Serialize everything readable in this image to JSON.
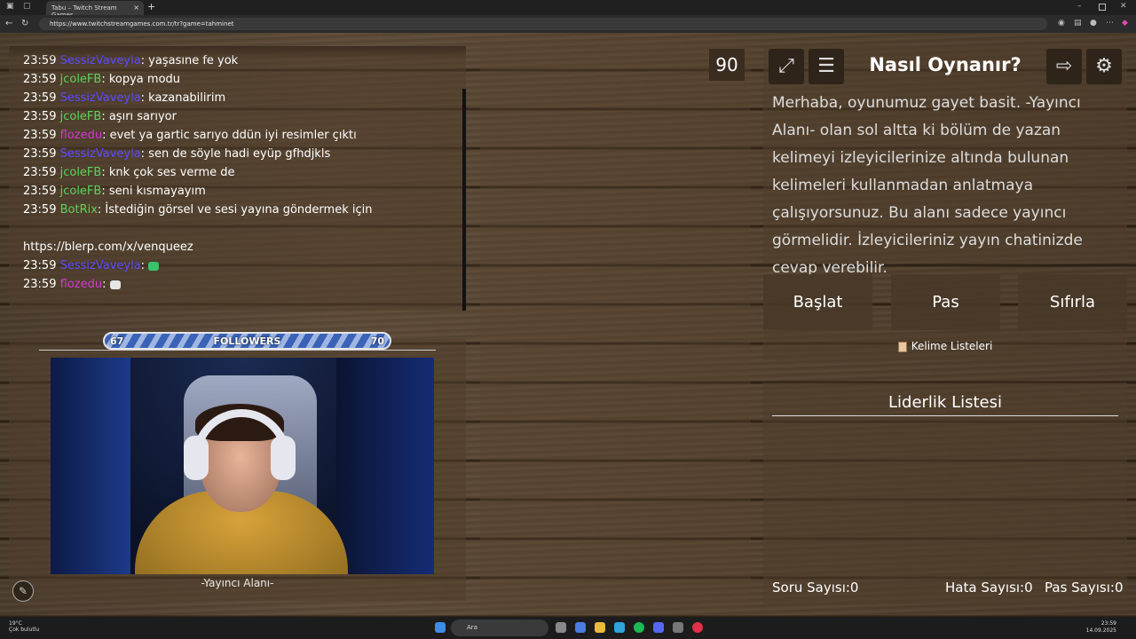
{
  "browser": {
    "tab_title": "Tabu – Twitch Stream Games",
    "url": "https://www.twitchstreamgames.com.tr/tr?game=tahminet"
  },
  "chat": {
    "messages": [
      {
        "time": "23:59",
        "user": "SessizVaveyla",
        "color": "#5b4cff",
        "text": ": yaşasıne fe yok"
      },
      {
        "time": "23:59",
        "user": "jcoleFB",
        "color": "#5dd35d",
        "text": ": kopya modu"
      },
      {
        "time": "23:59",
        "user": "SessizVaveyla",
        "color": "#5b4cff",
        "text": ": kazanabilirim"
      },
      {
        "time": "23:59",
        "user": "jcoleFB",
        "color": "#5dd35d",
        "text": ": aşırı sarıyor"
      },
      {
        "time": "23:59",
        "user": "flozedu",
        "color": "#d23bd2",
        "text": ": evet ya gartic sarıyo ddün iyi resimler çıktı"
      },
      {
        "time": "23:59",
        "user": "SessizVaveyla",
        "color": "#5b4cff",
        "text": ": sen de söyle hadi eyüp gfhdjkls"
      },
      {
        "time": "23:59",
        "user": "jcoleFB",
        "color": "#5dd35d",
        "text": ": knk çok ses verme de"
      },
      {
        "time": "23:59",
        "user": "jcoleFB",
        "color": "#5dd35d",
        "text": ": seni kısmayayım"
      },
      {
        "time": "23:59",
        "user": "BotRix",
        "color": "#5dd35d",
        "text": ": İstediğin görsel ve sesi yayına göndermek için"
      }
    ],
    "link_line": "https://blerp.com/x/venqueez",
    "emote_messages": [
      {
        "time": "23:59",
        "user": "SessizVaveyla",
        "color": "#5b4cff",
        "text": ": ",
        "emote_color": "#39c46a"
      },
      {
        "time": "23:59",
        "user": "flozedu",
        "color": "#d23bd2",
        "text": ": ",
        "emote_color": "#e6e6e6"
      }
    ]
  },
  "followers": {
    "label": "FOLLOWERS",
    "current": "67",
    "goal": "70",
    "progress": 0.957
  },
  "streamer_caption": "-Yayıncı Alanı-",
  "timer": "90",
  "howto": {
    "title": "Nasıl Oynanır?",
    "description": "Merhaba, oyunumuz gayet basit. -Yayıncı Alanı- olan sol altta ki bölüm de yazan kelimeyi izleyicilerinize altında bulunan kelimeleri kullanmadan anlatmaya çalışıyorsunuz. Bu alanı sadece yayıncı görmelidir. İzleyicileriniz yayın chatinizde cevap verebilir."
  },
  "actions": {
    "start": "Başlat",
    "pass": "Pas",
    "reset": "Sıfırla"
  },
  "word_lists": "Kelime Listeleri",
  "leaderboard": {
    "title": "Liderlik Listesi",
    "questions": "Soru Sayısı:0",
    "errors": "Hata Sayısı:0",
    "passes": "Pas Sayısı:0"
  },
  "taskbar": {
    "weather_temp": "19°C",
    "weather_text": "Çok bulutlu",
    "search": "Ara",
    "time": "23:59",
    "date": "14.09.2025"
  },
  "icons": [
    "expand-icon",
    "rules-icon",
    "exit-icon",
    "settings-icon",
    "pencil-icon",
    "notebook-icon"
  ]
}
